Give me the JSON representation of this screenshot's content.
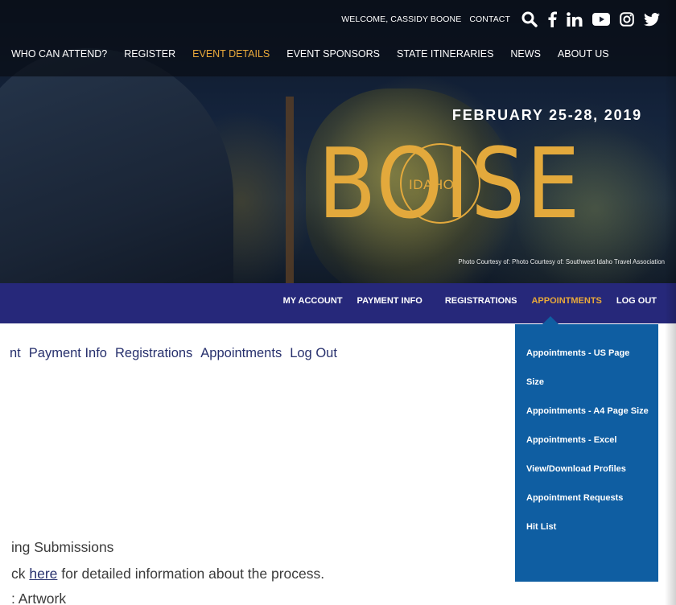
{
  "header": {
    "welcome": "WELCOME, CASSIDY BOONE",
    "contact": "CONTACT",
    "icons": [
      "search-icon",
      "facebook-icon",
      "linkedin-icon",
      "youtube-icon",
      "instagram-icon",
      "twitter-icon"
    ]
  },
  "mainnav": [
    {
      "label": "WHO CAN ATTEND?"
    },
    {
      "label": "REGISTER"
    },
    {
      "label": "EVENT DETAILS",
      "active": true
    },
    {
      "label": "EVENT SPONSORS"
    },
    {
      "label": "STATE ITINERARIES"
    },
    {
      "label": "NEWS"
    },
    {
      "label": "ABOUT US"
    }
  ],
  "hero": {
    "date": "FEBRUARY 25-28, 2019",
    "city": "BOISE",
    "state": "IDAHO",
    "credit": "Photo Courtesy of: Photo Courtesy of: Southwest Idaho Travel Association"
  },
  "account_nav": {
    "my_account": "MY ACCOUNT",
    "payment_info": "PAYMENT INFO",
    "registrations": "REGISTRATIONS",
    "appointments": "APPOINTMENTS",
    "log_out": "LOG OUT"
  },
  "sublinks": {
    "account": "nt",
    "payment_info": "Payment Info",
    "registrations": "Registrations",
    "appointments": "Appointments",
    "log_out": "Log Out"
  },
  "content": {
    "line1": "ing Submissions",
    "line2_before": "ck ",
    "line2_link": "here",
    "line2_after": " for detailed information about the process.",
    "line3": ": Artwork"
  },
  "appointments_menu": [
    "Appointments - US Page Size",
    "Appointments - A4 Page Size",
    "Appointments - Excel",
    "View/Download Profiles",
    "Appointment Requests",
    "Hit List"
  ],
  "colors": {
    "accent": "#e8a93a",
    "account_bar": "#26287a",
    "dropdown": "#0f5ea2",
    "link": "#27306d"
  }
}
